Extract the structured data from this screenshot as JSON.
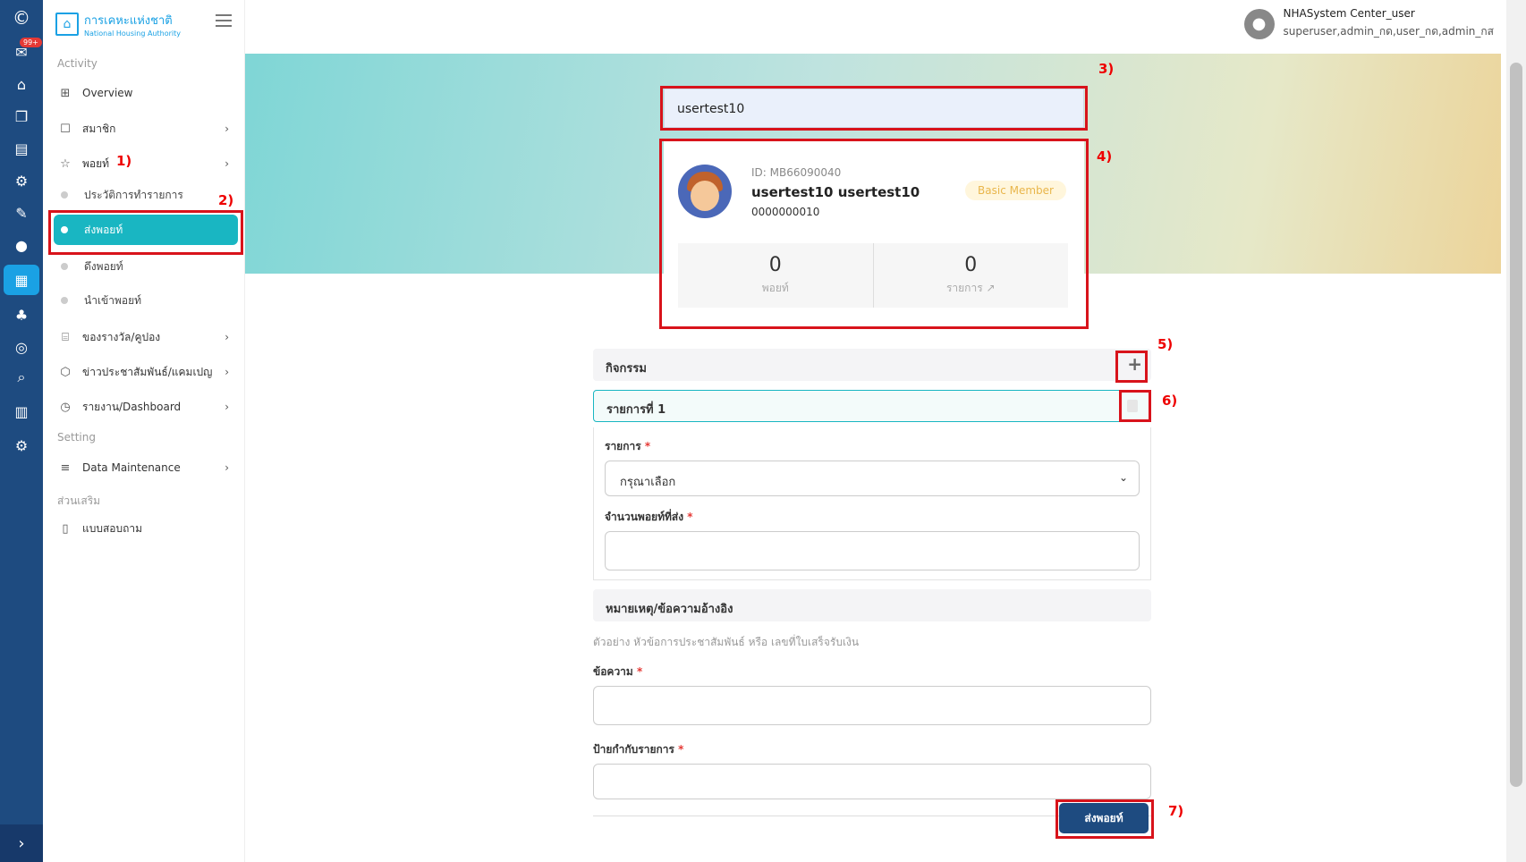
{
  "rail": {
    "badge": "99+"
  },
  "sidebar": {
    "logo_title": "การเคหะแห่งชาติ",
    "logo_sub": "National Housing Authority",
    "sections": {
      "activity": "Activity",
      "setting": "Setting",
      "extra": "ส่วนเสริม"
    },
    "items": [
      {
        "label": "Overview"
      },
      {
        "label": "สมาชิก"
      },
      {
        "label": "พอยท์"
      },
      {
        "label": "ของรางวัล/คูปอง"
      },
      {
        "label": "ข่าวประชาสัมพันธ์/แคมเปญ"
      },
      {
        "label": "รายงาน/Dashboard"
      },
      {
        "label": "Data Maintenance"
      },
      {
        "label": "แบบสอบถาม"
      }
    ],
    "subitems": [
      {
        "label": "ประวัติการทำรายการ"
      },
      {
        "label": "ส่งพอยท์"
      },
      {
        "label": "ดึงพอยท์"
      },
      {
        "label": "นำเข้าพอยท์"
      }
    ]
  },
  "user": {
    "name": "NHASystem Center_user",
    "roles": "superuser,admin_กด,user_กด,admin_กส"
  },
  "search": {
    "value": "usertest10"
  },
  "member": {
    "id": "ID: MB66090040",
    "name": "usertest10  usertest10",
    "phone": "0000000010",
    "tier": "Basic Member",
    "points_value": "0",
    "points_label": "พอยท์",
    "tx_value": "0",
    "tx_label": "รายการ"
  },
  "form": {
    "activity_label": "กิจกรรม",
    "item_label": "รายการที่ 1",
    "field_item_label": "รายการ",
    "field_item_placeholder": "กรุณาเลือก",
    "field_points_label": "จำนวนพอยท์ที่ส่ง",
    "note_section": "หมายเหตุ/ข้อความอ้างอิง",
    "note_hint": "ตัวอย่าง หัวข้อการประชาสัมพันธ์ หรือ เลขที่ใบเสร็จรับเงิน",
    "field_message_label": "ข้อความ",
    "field_tag_label": "ป้ายกำกับรายการ",
    "submit_label": "ส่งพอยท์"
  },
  "annotations": [
    "1)",
    "2)",
    "3)",
    "4)",
    "5)",
    "6)",
    "7)"
  ],
  "colors": {
    "rail": "#1e4b80",
    "accent": "#19b6c2",
    "annotation": "#d8131b",
    "primary_button": "#1e4b80"
  }
}
